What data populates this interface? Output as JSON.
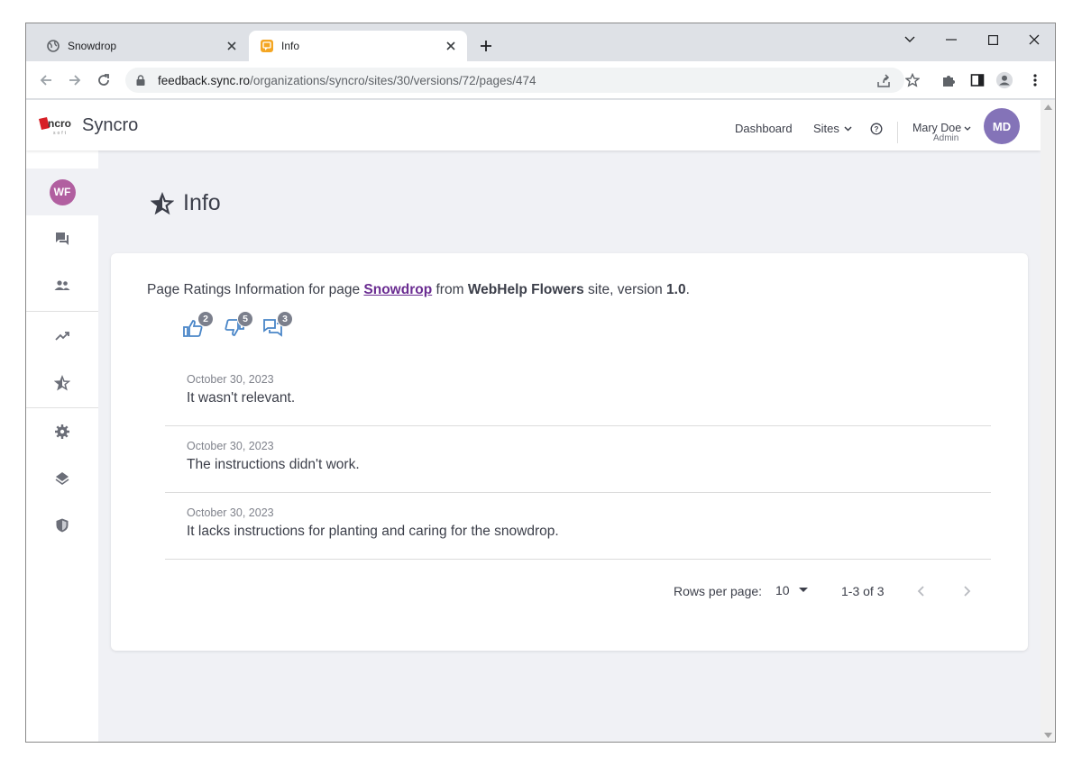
{
  "browser": {
    "tabs": [
      {
        "title": "Snowdrop",
        "active": false
      },
      {
        "title": "Info",
        "active": true
      }
    ],
    "url_host": "feedback.sync.ro",
    "url_path": "/organizations/syncro/sites/30/versions/72/pages/474"
  },
  "app": {
    "brand": "Syncro",
    "nav": {
      "dashboard": "Dashboard",
      "sites": "Sites"
    },
    "user": {
      "name": "Mary Doe",
      "role": "Admin",
      "initials": "MD"
    },
    "sidebar_avatar": "WF"
  },
  "page": {
    "title": "Info",
    "info": {
      "prefix": "Page Ratings Information for page ",
      "page_link": "Snowdrop",
      "from": " from ",
      "site": "WebHelp Flowers",
      "site_suffix": " site, version ",
      "version": "1.0",
      "end": "."
    },
    "stats": {
      "likes": "2",
      "dislikes": "5",
      "comments": "3"
    },
    "feedback": [
      {
        "date": "October 30, 2023",
        "text": "It wasn't relevant."
      },
      {
        "date": "October 30, 2023",
        "text": "The instructions didn't work."
      },
      {
        "date": "October 30, 2023",
        "text": "It lacks instructions for planting and caring for the snowdrop."
      }
    ],
    "pagination": {
      "rows_label": "Rows per page:",
      "rows_value": "10",
      "range": "1-3 of 3"
    }
  },
  "colors": {
    "accent": "#4a86c8",
    "avatar_md": "#8473b8",
    "avatar_wf": "#b15fa0",
    "link": "#6a2c91"
  }
}
